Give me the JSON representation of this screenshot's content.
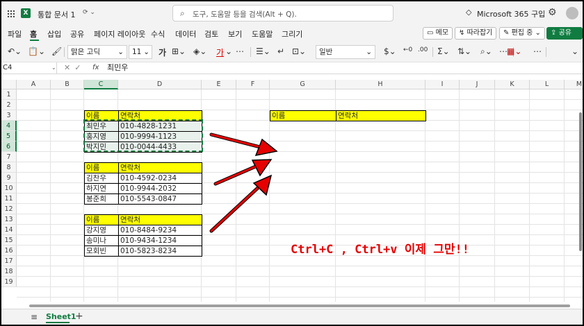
{
  "titlebar": {
    "doc_title": "통합 문서 1",
    "search_placeholder": "도구, 도움말 등을 검색(Alt + Q).",
    "ms365": "Microsoft 365 구입"
  },
  "ribbon": {
    "tabs": [
      "파일",
      "홈",
      "삽입",
      "공유",
      "페이지 레이아웃",
      "수식",
      "데이터",
      "검토",
      "보기",
      "도움말",
      "그리기"
    ],
    "memo": "메모",
    "follow": "따라잡기",
    "edit": "편집 중",
    "share": "공유"
  },
  "toolbar": {
    "font": "맑은 고딕",
    "size": "11",
    "bold": "가",
    "font_color": "가",
    "number_format": "일반"
  },
  "formula_bar": {
    "name_box": "C4",
    "value": "최민우"
  },
  "grid": {
    "columns": [
      "A",
      "B",
      "C",
      "D",
      "E",
      "F",
      "G",
      "H",
      "I",
      "J",
      "K",
      "L",
      "M"
    ],
    "selected_column": "C",
    "rows": [
      "1",
      "2",
      "3",
      "4",
      "5",
      "6",
      "7",
      "8",
      "9",
      "10",
      "11",
      "12",
      "13",
      "14",
      "15",
      "16",
      "17",
      "18",
      "19"
    ],
    "selected_rows": [
      "4",
      "5",
      "6"
    ]
  },
  "tables": [
    {
      "header": [
        "이름",
        "연락처"
      ],
      "rows": [
        [
          "최민우",
          "010-4828-1231"
        ],
        [
          "홍지영",
          "010-9994-1123"
        ],
        [
          "박지민",
          "010-0044-4433"
        ]
      ]
    },
    {
      "header": [
        "이름",
        "연락처"
      ],
      "rows": [
        [
          "김찬우",
          "010-4592-0234"
        ],
        [
          "하지연",
          "010-9944-2032"
        ],
        [
          "봉준희",
          "010-5543-0847"
        ]
      ]
    },
    {
      "header": [
        "이름",
        "연락처"
      ],
      "rows": [
        [
          "강지영",
          "010-8484-9234"
        ],
        [
          "송미나",
          "010-9434-1234"
        ],
        [
          "모회빈",
          "010-5823-8234"
        ]
      ]
    }
  ],
  "target_header": [
    "이름",
    "연락처"
  ],
  "annotation": {
    "text": "Ctrl+C , Ctrl+v 이제 그만!!",
    "color": "#e60000"
  },
  "sheets": {
    "active": "Sheet1"
  },
  "colors": {
    "accent": "#107c41",
    "header_fill": "#ffff00"
  }
}
